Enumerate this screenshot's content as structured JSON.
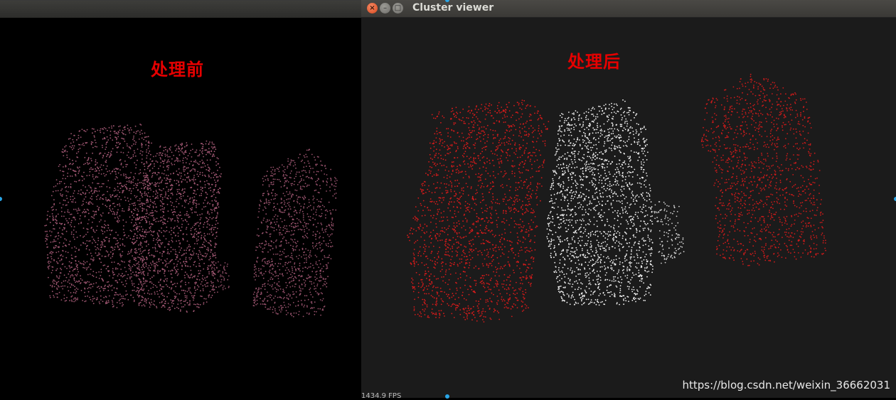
{
  "left_pane": {
    "label": "处理前",
    "point_color": "#b0607e"
  },
  "right_window": {
    "title": "Cluster viewer",
    "label": "处理后",
    "fps": "1434.9 FPS",
    "cluster_colors": [
      "#e01b1b",
      "#ffffff",
      "#e01b1b"
    ]
  },
  "watermark": "https://blog.csdn.net/weixin_36662031",
  "colors": {
    "label_red": "#e60000",
    "right_background": "#1b1b1b",
    "left_background": "#000000",
    "handle_blue": "#29a6e8"
  },
  "icons": [
    "close-icon",
    "minimize-icon",
    "maximize-icon"
  ]
}
